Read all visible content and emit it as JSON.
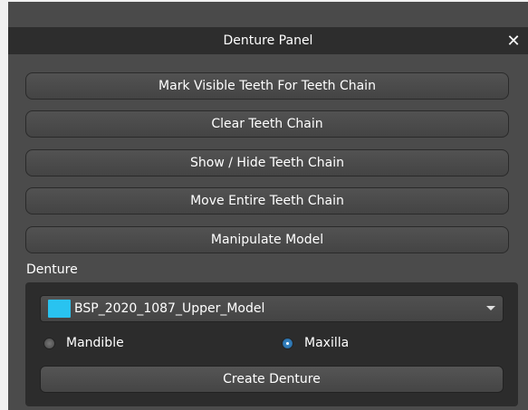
{
  "panel": {
    "title": "Denture Panel",
    "close_label": "✕"
  },
  "buttons": {
    "mark_visible": "Mark Visible Teeth For Teeth Chain",
    "clear_chain": "Clear Teeth Chain",
    "show_hide": "Show / Hide Teeth Chain",
    "move_chain": "Move Entire Teeth Chain",
    "manipulate": "Manipulate Model"
  },
  "denture": {
    "section_label": "Denture",
    "model_select": {
      "selected": "BSP_2020_1087_Upper_Model",
      "swatch_color": "#29c3f0"
    },
    "radios": [
      {
        "label": "Mandible",
        "checked": false
      },
      {
        "label": "Maxilla",
        "checked": true
      }
    ],
    "create_button": "Create Denture"
  }
}
